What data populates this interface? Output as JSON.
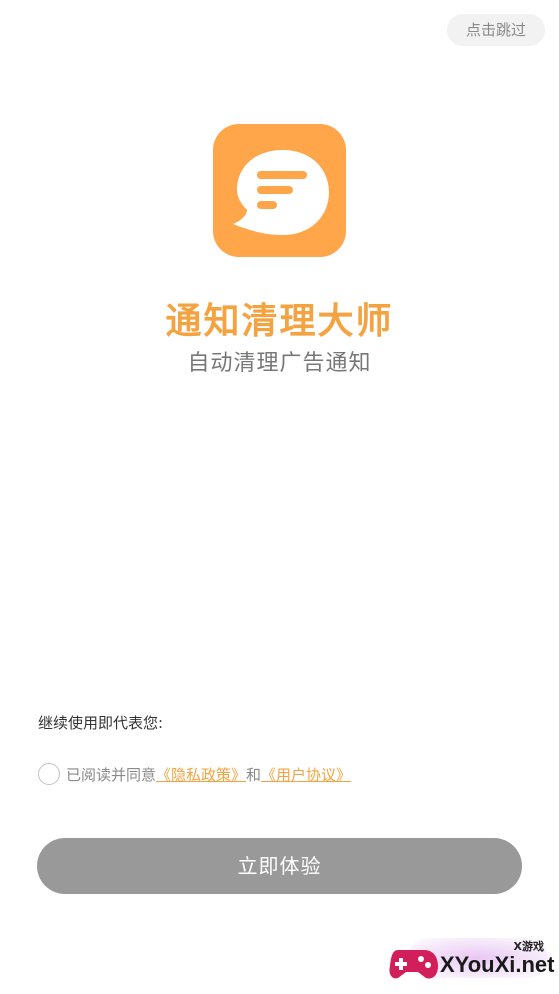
{
  "header": {
    "skip_label": "点击跳过"
  },
  "branding": {
    "logo_icon": "chat-bubble-lines-icon",
    "app_name": "通知清理大师",
    "tagline": "自动清理广告通知"
  },
  "agreement": {
    "notice": "继续使用即代表您:",
    "prefix": "已阅读并同意",
    "privacy_link": "《隐私政策》",
    "connector": "和",
    "terms_link": "《用户协议》",
    "checked": false
  },
  "actions": {
    "start_label": "立即体验"
  },
  "watermark": {
    "small": "X游戏",
    "main": "XYouXi.net"
  },
  "colors": {
    "brand": "#f5a341",
    "logo_bg": "#ffa54a",
    "button_bg": "#999999",
    "text_muted": "#8a8a8a"
  }
}
